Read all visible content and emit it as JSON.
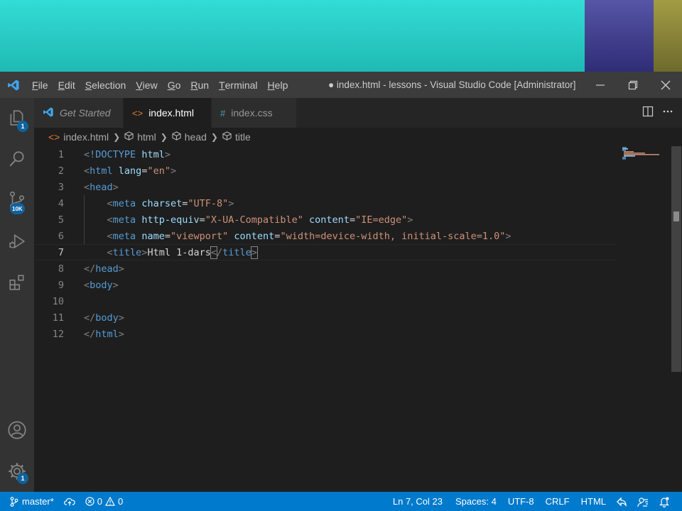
{
  "window": {
    "title": "● index.html - lessons - Visual Studio Code [Administrator]"
  },
  "menu": {
    "items": [
      {
        "first": "F",
        "rest": "ile"
      },
      {
        "first": "E",
        "rest": "dit"
      },
      {
        "first": "S",
        "rest": "election"
      },
      {
        "first": "V",
        "rest": "iew"
      },
      {
        "first": "G",
        "rest": "o"
      },
      {
        "first": "R",
        "rest": "un"
      },
      {
        "first": "T",
        "rest": "erminal"
      },
      {
        "first": "H",
        "rest": "elp"
      }
    ]
  },
  "activity": {
    "explorer_badge": "1",
    "scm_badge": "10K",
    "settings_badge": "1"
  },
  "tabs": [
    {
      "label": "Get Started",
      "icon": "vscode-logo-icon",
      "active": false
    },
    {
      "label": "index.html",
      "icon": "html-file-icon",
      "active": true,
      "dirty": true
    },
    {
      "label": "index.css",
      "icon": "css-file-icon",
      "active": false
    }
  ],
  "breadcrumb": {
    "file": "index.html",
    "path": [
      "html",
      "head",
      "title"
    ]
  },
  "editor": {
    "line_numbers": [
      "1",
      "2",
      "3",
      "4",
      "5",
      "6",
      "7",
      "8",
      "9",
      "10",
      "11",
      "12"
    ],
    "current_line": "7"
  },
  "statusbar": {
    "branch": "master*",
    "errors": "0",
    "warnings": "0",
    "position": "Ln 7, Col 23",
    "spaces": "Spaces: 4",
    "encoding": "UTF-8",
    "eol": "CRLF",
    "language": "HTML"
  },
  "colors": {
    "statusbar": "#007acc",
    "titlebar": "#3c3c3c",
    "activitybar": "#333333",
    "editor_bg": "#1e1e1e",
    "tag": "#569cd6",
    "attr": "#9cdcfe",
    "string": "#ce9178"
  }
}
